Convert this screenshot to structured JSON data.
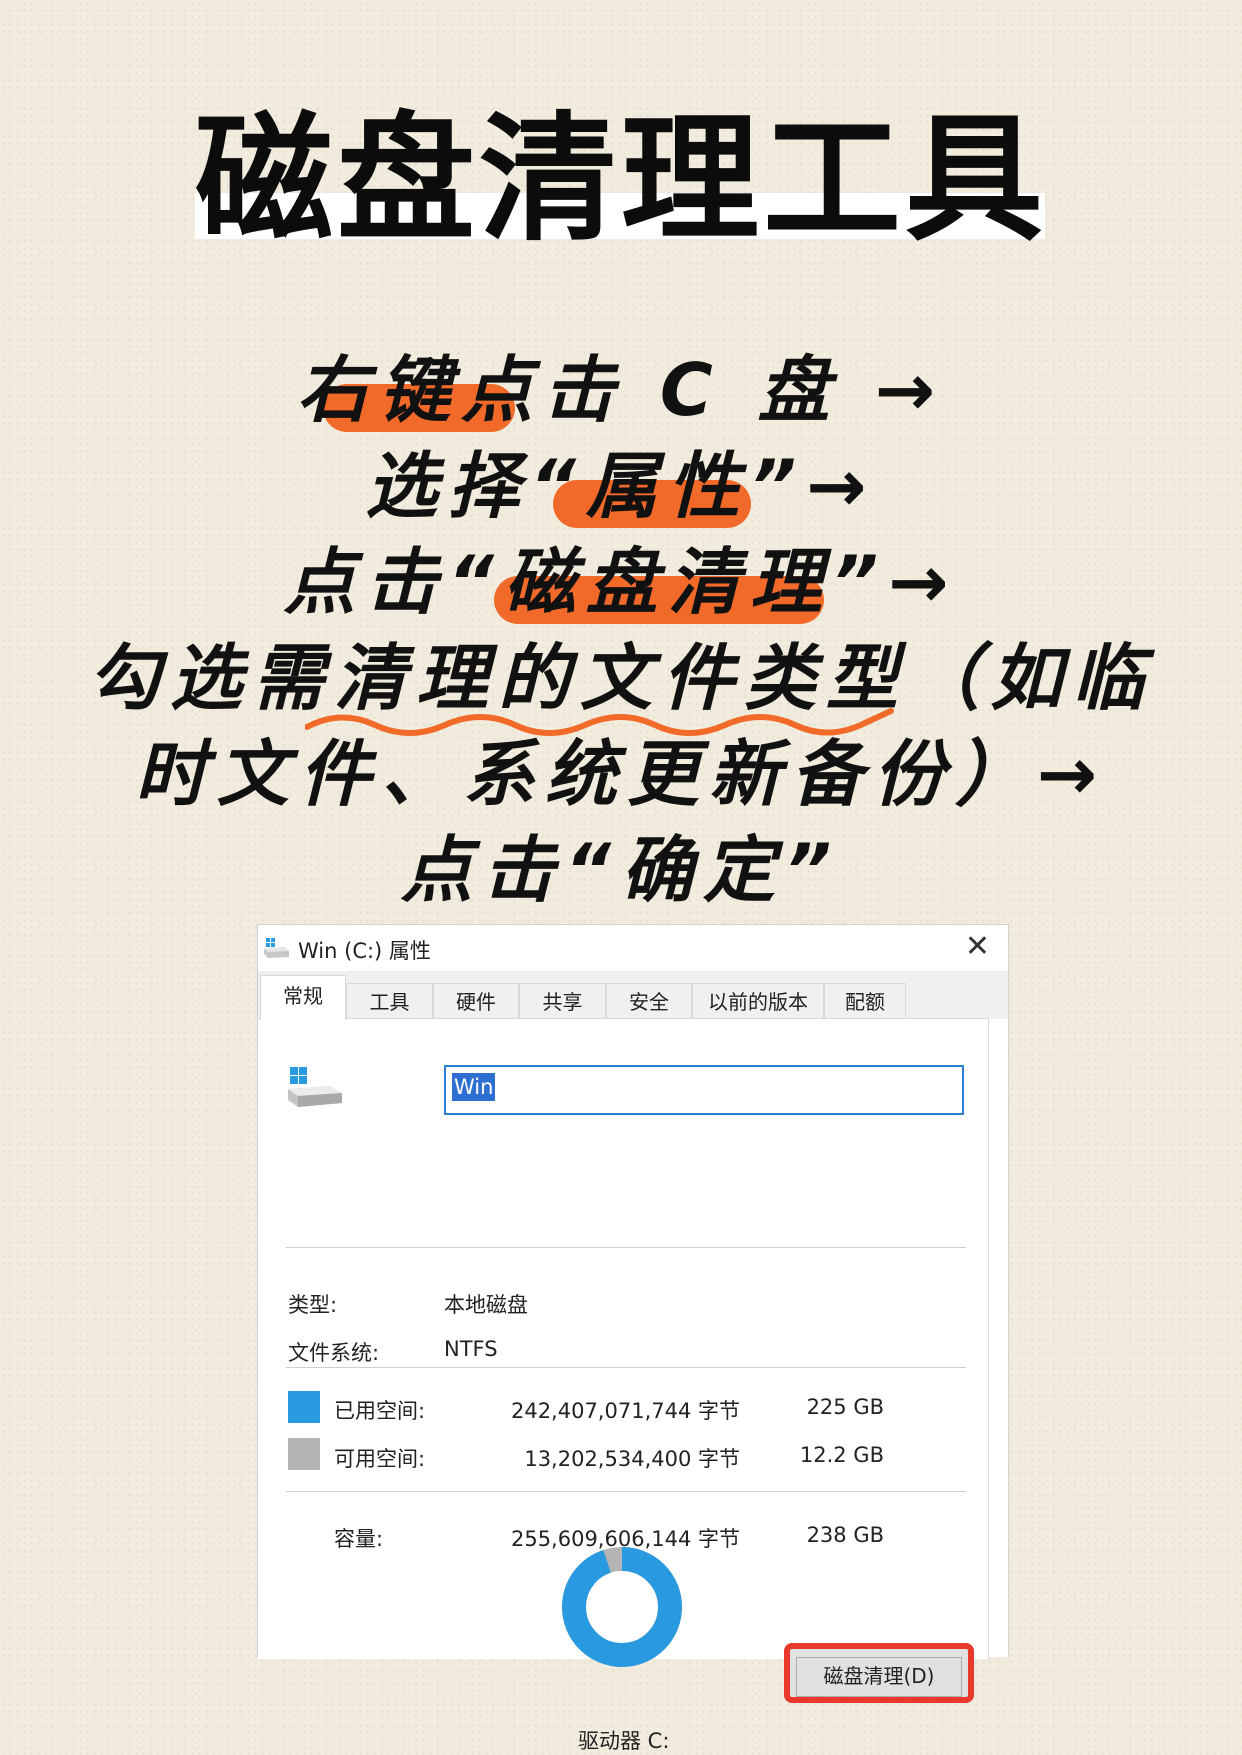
{
  "title": "磁盘清理工具",
  "steps": {
    "line1": "右键点击 C 盘 →",
    "line2": "选择“属性”→",
    "line3": "点击“磁盘清理”→",
    "line4": "勾选需清理的文件类型（如临",
    "line5": "时文件、系统更新备份）→",
    "line6": "点击“确定”"
  },
  "dialog": {
    "title": "Win (C:) 属性",
    "tabs": [
      "常规",
      "工具",
      "硬件",
      "共享",
      "安全",
      "以前的版本",
      "配额"
    ],
    "active_tab": "常规",
    "name_value": "Win",
    "type_label": "类型:",
    "type_value": "本地磁盘",
    "fs_label": "文件系统:",
    "fs_value": "NTFS",
    "used": {
      "label": "已用空间:",
      "bytes": "242,407,071,744 字节",
      "size": "225 GB",
      "color": "#2a9ae0"
    },
    "free": {
      "label": "可用空间:",
      "bytes": "13,202,534,400 字节",
      "size": "12.2 GB",
      "color": "#b4b4b4"
    },
    "capacity": {
      "label": "容量:",
      "bytes": "255,609,606,144 字节",
      "size": "238 GB"
    },
    "drive_label": "驱动器 C:",
    "cleanup_button": "磁盘清理(D)",
    "used_fraction": 0.948
  },
  "colors": {
    "accent": "#f26a2a",
    "highlight_box": "#e8392c",
    "background": "#f1ecdd"
  }
}
